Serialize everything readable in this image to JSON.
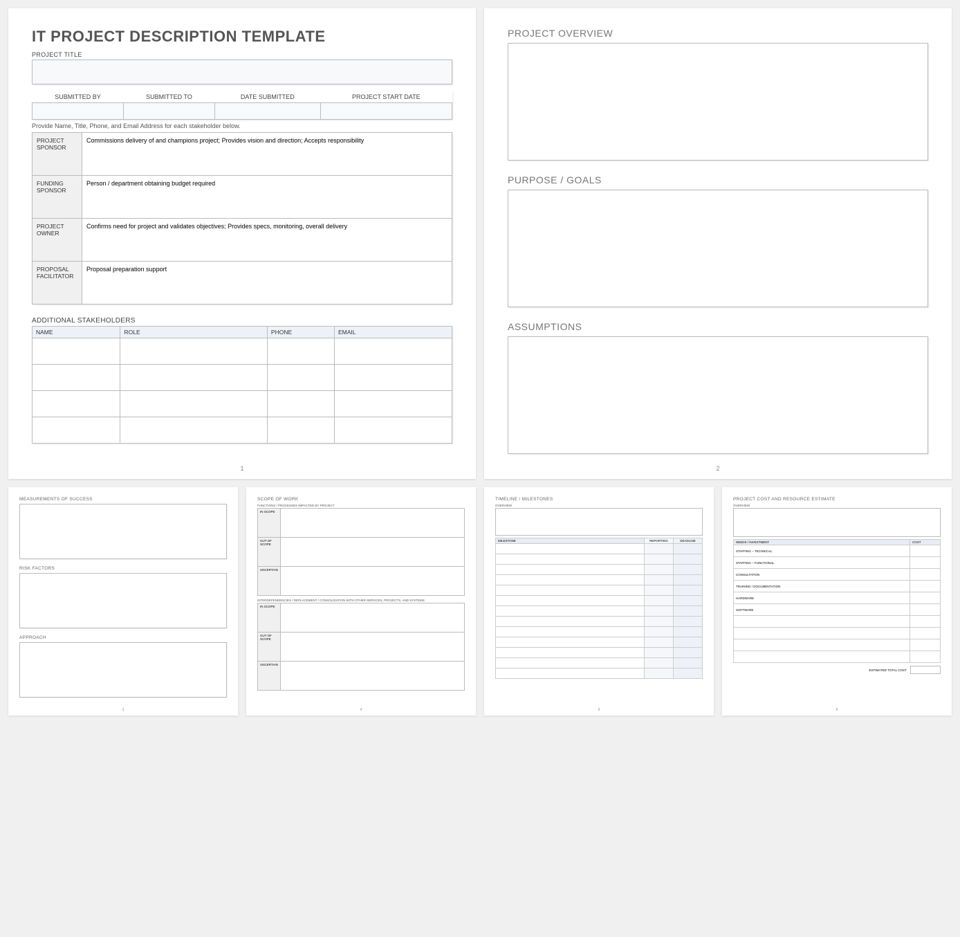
{
  "p1": {
    "title": "IT PROJECT DESCRIPTION TEMPLATE",
    "projectTitleLabel": "PROJECT TITLE",
    "submit": [
      "SUBMITTED BY",
      "SUBMITTED TO",
      "DATE SUBMITTED",
      "PROJECT START DATE"
    ],
    "note": "Provide Name, Title, Phone, and Email Address for each stakeholder below.",
    "rows": [
      {
        "h": "PROJECT SPONSOR",
        "t": "Commissions delivery of and champions project; Provides vision and direction; Accepts responsibility"
      },
      {
        "h": "FUNDING SPONSOR",
        "t": "Person / department obtaining budget required"
      },
      {
        "h": "PROJECT OWNER",
        "t": "Confirms need for project and validates objectives; Provides specs, monitoring, overall delivery"
      },
      {
        "h": "PROPOSAL FACILITATOR",
        "t": "Proposal preparation support"
      }
    ],
    "addTitle": "ADDITIONAL STAKEHOLDERS",
    "addCols": [
      "NAME",
      "ROLE",
      "PHONE",
      "EMAIL"
    ],
    "pg": "1"
  },
  "p2": {
    "s1": "PROJECT OVERVIEW",
    "s2": "PURPOSE / GOALS",
    "s3": "ASSUMPTIONS",
    "pg": "2"
  },
  "p3": {
    "s1": "MEASUREMENTS OF SUCCESS",
    "s2": "RISK FACTORS",
    "s3": "APPROACH",
    "pg": "3"
  },
  "p4": {
    "title": "SCOPE OF WORK",
    "sub1": "FUNCTIONS / PROCESSES IMPACTED BY PROJECT",
    "sub2": "INTERDEPENDENCIES / REPLACEMENT / CONSOLIDATION WITH OTHER SERVICES, PROJECTS, AND SYSTEMS",
    "rows": [
      "IN SCOPE",
      "OUT OF SCOPE",
      "UNCERTAIN"
    ],
    "pg": "4"
  },
  "p5": {
    "title": "TIMELINE / MILESTONES",
    "ov": "OVERVIEW",
    "cols": [
      "MILESTONE",
      "REPORTING",
      "DEADLINE"
    ],
    "pg": "5"
  },
  "p6": {
    "title": "PROJECT COST AND RESOURCE ESTIMATE",
    "ov": "OVERVIEW",
    "cols": [
      "NEEDS / INVESTMENT",
      "COST"
    ],
    "items": [
      "STAFFING – TECHNICAL",
      "STAFFING – FUNCTIONAL",
      "CONSULTATION",
      "TRAINING / DOCUMENTATION",
      "HARDWARE",
      "SOFTWARE",
      "",
      "",
      "",
      ""
    ],
    "total": "ESTIMATED TOTAL COST",
    "pg": "6"
  }
}
